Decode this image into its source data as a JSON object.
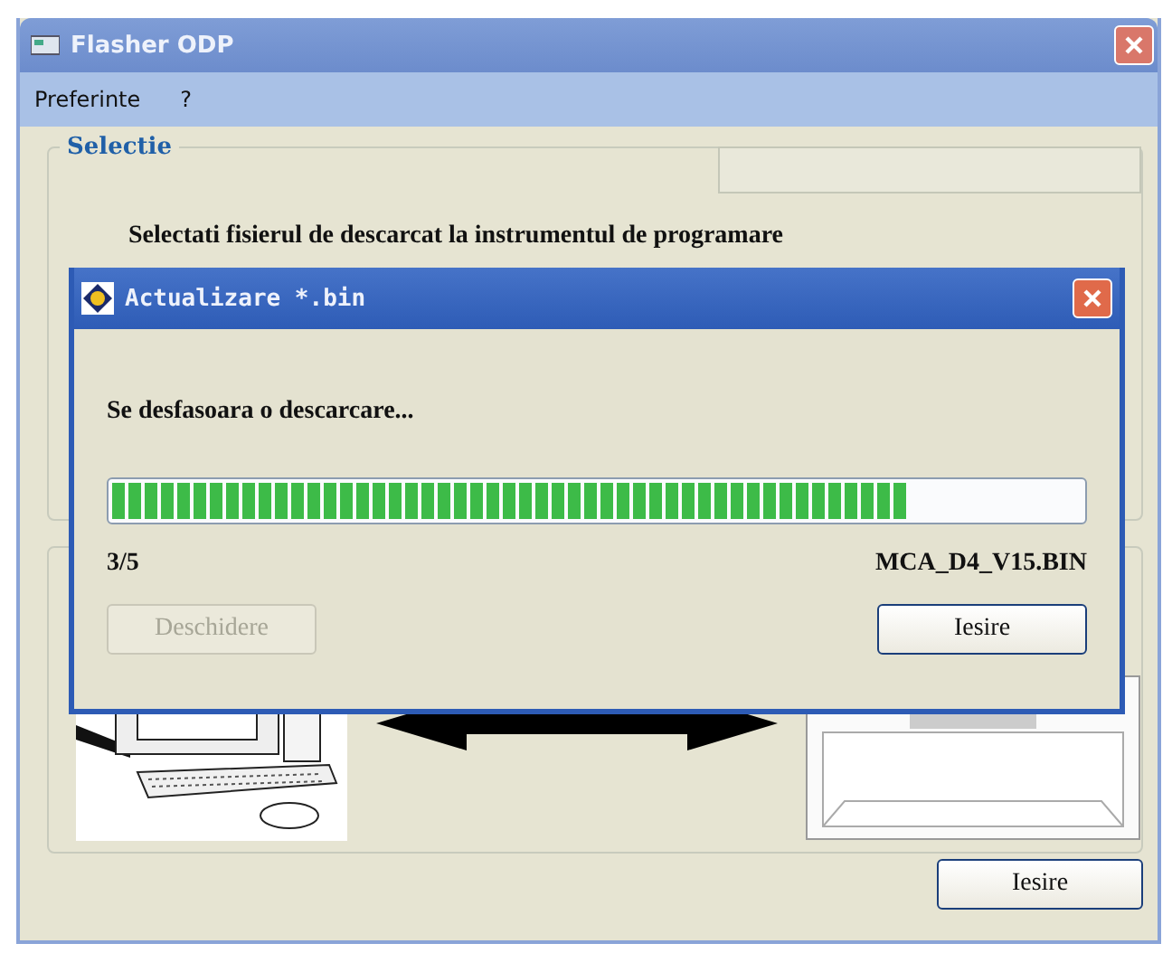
{
  "window": {
    "title": "Flasher ODP"
  },
  "menu": [
    "Preferinte",
    "?"
  ],
  "selection_group": {
    "title": "Selectie",
    "instruction": "Selectati fisierul de descarcat la instrumentul de programare"
  },
  "exit_button": {
    "label": "Iesire"
  },
  "dialog": {
    "title": "Actualizare *.bin",
    "message": "Se desfasoara o descarcare...",
    "progress": {
      "level": 0.82
    },
    "count": "3/5",
    "file": "MCA_D4_V15.BIN",
    "buttons": [
      {
        "label": "Deschidere",
        "disabled": true
      },
      {
        "label": "Iesire",
        "disabled": false
      }
    ]
  }
}
